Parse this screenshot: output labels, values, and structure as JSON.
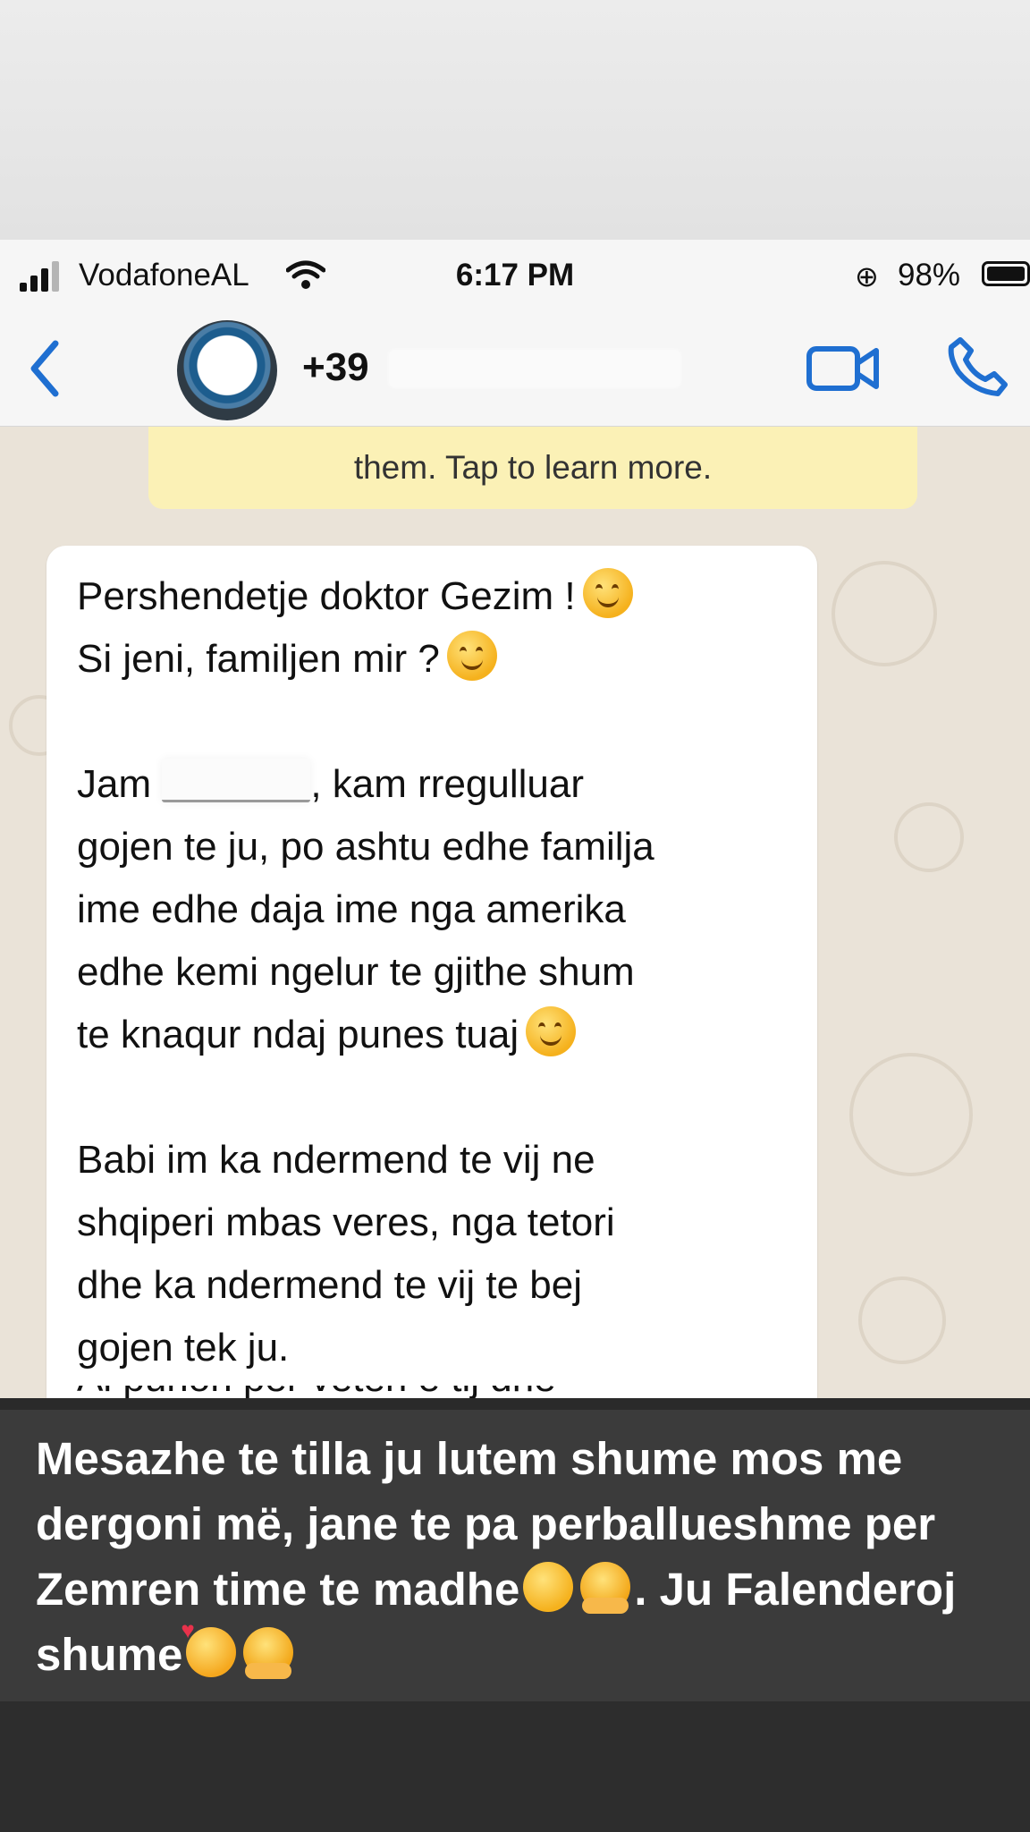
{
  "statusbar": {
    "carrier": "VodafoneAL",
    "time": "6:17 PM",
    "battery": "98%"
  },
  "header": {
    "contact": "+39"
  },
  "notice": {
    "text": "them. Tap to learn more."
  },
  "message": {
    "line1": "Pershendetje doktor Gezim !",
    "line2": "Si jeni, familjen mir ?",
    "line3a": "Jam",
    "line3b": ", kam rregulluar",
    "line4": "gojen te ju, po ashtu edhe familja",
    "line5": "ime edhe daja ime nga amerika",
    "line6": "edhe kemi ngelur te gjithe shum",
    "line7": "te knaqur ndaj punes tuaj",
    "line8": "Babi im ka ndermend te vij ne",
    "line9": "shqiperi mbas veres, nga tetori",
    "line10": "dhe ka ndermend te vij te bej",
    "line11": "gojen tek ju.",
    "line12": "Ai punon per vetën e tij dhe"
  },
  "caption": {
    "part1": "Mesazhe te tilla ju lutem shume mos me dergoni më, jane te pa perballueshme per Zemren time te madhe",
    "part2": ". Ju Falenderoj shume"
  },
  "icons": [
    "signal-icon",
    "wifi-icon",
    "orientation-lock-icon",
    "battery-icon",
    "back-chevron-icon",
    "video-call-icon",
    "phone-call-icon",
    "smiling-face-emoji",
    "hugging-face-emoji",
    "smiling-face-with-hearts-emoji"
  ],
  "colors": {
    "ios_blue": "#1f6fd1",
    "notice_yellow": "#fbf1b6",
    "chat_background": "#eae3d8",
    "caption_band": "#3b3b3b"
  }
}
